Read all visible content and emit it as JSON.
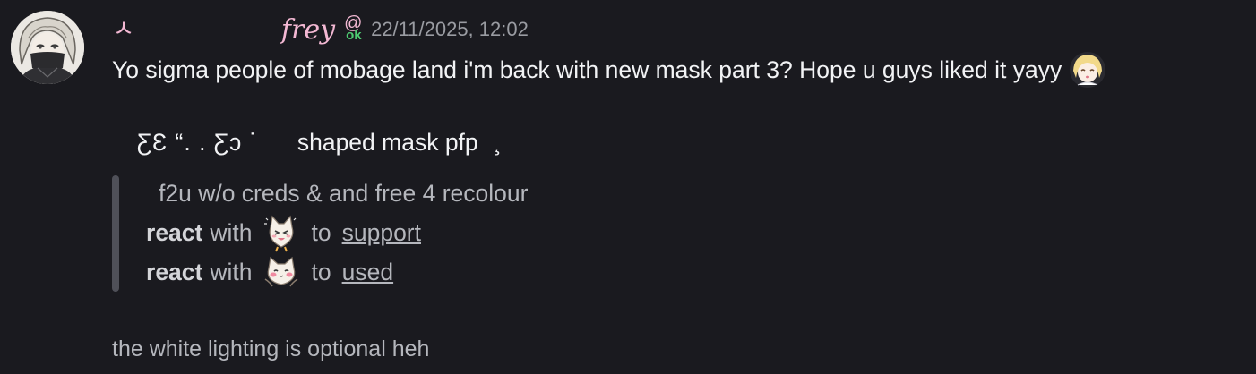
{
  "message": {
    "name_prefix": "ㅅ",
    "username": "frey",
    "tag_symbol": "@",
    "tag_text": "ok",
    "timestamp": "22/11/2025, 12:02",
    "line1": "Yo sigma people of mobage land i'm back with new mask part 3? Hope u guys liked it yayy",
    "deco_kaomoji": "ƸƐ “. . Ƹɔ ˙",
    "deco_text": "shaped mask pfp",
    "deco_tail": "¸",
    "quote": {
      "line1": "f2u w/o creds & and free 4 recolour",
      "react_word": "react",
      "with_word": "with",
      "to_word": "to",
      "support_link": "support",
      "used_link": "used"
    },
    "note": "the white lighting is optional heh"
  },
  "colors": {
    "background": "#1a1a1f",
    "username": "#f3b8d3",
    "tag_ok": "#4ecb71",
    "timestamp": "#9a9ca2",
    "quote_bar": "#4f5058"
  },
  "icons": {
    "avatar": "anime-avatar-masked",
    "inline_emoji": "blonde-anime-emoji",
    "support_emoji": "cat-excited-emoji",
    "used_emoji": "cat-blush-emoji"
  }
}
